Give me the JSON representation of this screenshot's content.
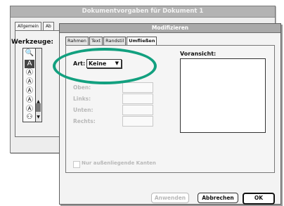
{
  "back_window": {
    "title": "Dokumentvorgaben für Dokument 1",
    "tabs": [
      "Allgemein",
      "Ab"
    ],
    "werkzeuge_label": "Werkzeuge:"
  },
  "dialog": {
    "title": "Modifizieren",
    "tabs": [
      {
        "label": "Rahmen",
        "active": false
      },
      {
        "label": "Text",
        "active": false
      },
      {
        "label": "Randstil",
        "active": false
      },
      {
        "label": "Umfließen",
        "active": true
      }
    ],
    "art_label": "Art:",
    "art_value": "Keine",
    "fields": [
      {
        "label": "Oben:",
        "value": ""
      },
      {
        "label": "Links:",
        "value": ""
      },
      {
        "label": "Unten:",
        "value": ""
      },
      {
        "label": "Rechts:",
        "value": ""
      }
    ],
    "preview_label": "Voransicht:",
    "checkbox_label": "Nur außenliegende Kanten",
    "buttons": {
      "apply": "Anwenden",
      "cancel": "Abbrechen",
      "ok": "OK"
    }
  },
  "colors": {
    "highlight": "#12a07f",
    "disabled_text": "#b8b8b8"
  }
}
